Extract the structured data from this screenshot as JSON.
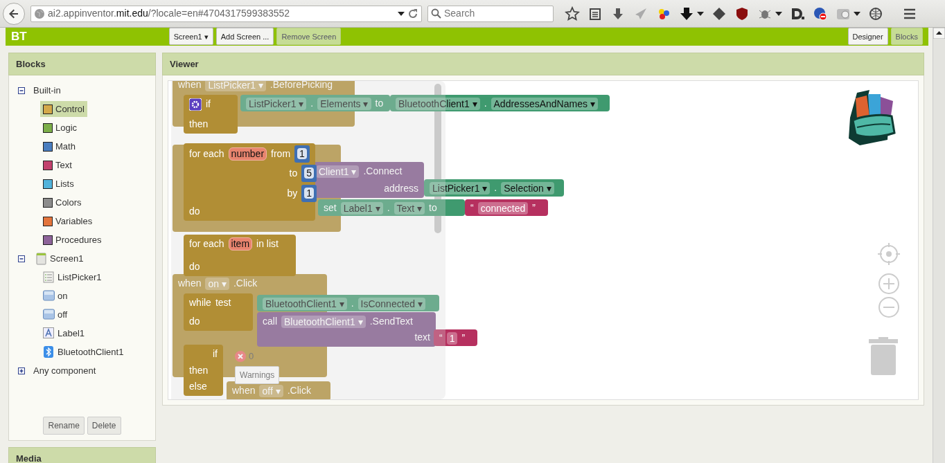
{
  "browser": {
    "url": "ai2.appinventor.**mit.edu**/?locale=en#4704317599383552",
    "search": {
      "placeholder": "Search"
    }
  },
  "app": {
    "project": "BT",
    "screen_button": "Screen1 ▾",
    "buttons": [
      {
        "label": "Add Screen ...",
        "disabled": false
      },
      {
        "label": "Remove Screen",
        "disabled": true
      }
    ],
    "views": [
      {
        "label": "Designer",
        "selected": false
      },
      {
        "label": "Blocks",
        "selected": true
      }
    ]
  },
  "blocks_panel": {
    "title": "Blocks",
    "tree": [
      {
        "label": "Built-in",
        "kind": "group",
        "expanded": true,
        "children": [
          {
            "label": "Control",
            "kind": "category",
            "color": "#d4a94a",
            "selected": true
          },
          {
            "label": "Logic",
            "kind": "category",
            "color": "#7cae4a",
            "selected": false
          },
          {
            "label": "Math",
            "kind": "category",
            "color": "#4a7dbf",
            "selected": false
          },
          {
            "label": "Text",
            "kind": "category",
            "color": "#c2416d",
            "selected": false
          },
          {
            "label": "Lists",
            "kind": "category",
            "color": "#52b3db",
            "selected": false
          },
          {
            "label": "Colors",
            "kind": "category",
            "color": "#8c8c8c",
            "selected": false
          },
          {
            "label": "Variables",
            "kind": "category",
            "color": "#e3743c",
            "selected": false
          },
          {
            "label": "Procedures",
            "kind": "category",
            "color": "#8d6399",
            "selected": false
          }
        ]
      },
      {
        "label": "Screen1",
        "kind": "screen",
        "expanded": true,
        "children": [
          {
            "label": "ListPicker1",
            "kind": "listpicker",
            "selected": false
          },
          {
            "label": "on",
            "kind": "button",
            "selected": false
          },
          {
            "label": "off",
            "kind": "button",
            "selected": false
          },
          {
            "label": "Label1",
            "kind": "label",
            "selected": false
          },
          {
            "label": "BluetoothClient1",
            "kind": "bluetooth",
            "selected": false
          }
        ]
      },
      {
        "label": "Any component",
        "kind": "group",
        "expanded": false
      }
    ],
    "buttons": [
      "Rename",
      "Delete"
    ]
  },
  "media_panel": {
    "title": "Media"
  },
  "viewer": {
    "title": "Viewer",
    "workspace_blocks": [
      {
        "kind": "event",
        "rows": [
          [
            {
              "kind": "label",
              "text": "when"
            },
            {
              "kind": "dd",
              "text": "ListPicker1 ▾"
            },
            {
              "kind": "label",
              "text": ".BeforePicking"
            }
          ]
        ]
      },
      {
        "kind": "setter",
        "rows": [
          [
            {
              "kind": "dd",
              "text": "ListPicker1 ▾"
            },
            {
              "kind": "label",
              "text": "."
            },
            {
              "kind": "dd",
              "text": "Elements ▾"
            },
            {
              "kind": "label",
              "text": "to"
            }
          ]
        ]
      },
      {
        "kind": "getter",
        "rows": [
          [
            {
              "kind": "dd",
              "text": "BluetoothClient1 ▾"
            },
            {
              "kind": "label",
              "text": "."
            },
            {
              "kind": "dd",
              "text": "AddressesAndNames ▾"
            }
          ]
        ]
      },
      {
        "kind": "event"
      },
      {
        "kind": "call",
        "rows": [
          [
            {
              "kind": "dd",
              "text": "Client1 ▾"
            },
            {
              "kind": "label",
              "text": ".Connect"
            }
          ],
          [
            {
              "kind": "label",
              "text": "address"
            }
          ]
        ]
      },
      {
        "kind": "getter",
        "rows": [
          [
            {
              "kind": "dd",
              "text": "ListPicker1 ▾"
            },
            {
              "kind": "label",
              "text": "."
            },
            {
              "kind": "dd",
              "text": "Selection ▾"
            }
          ]
        ]
      },
      {
        "kind": "setter",
        "rows": [
          [
            {
              "kind": "label",
              "text": "set"
            },
            {
              "kind": "dd",
              "text": "Label1 ▾"
            },
            {
              "kind": "label",
              "text": "."
            },
            {
              "kind": "dd",
              "text": "Text ▾"
            },
            {
              "kind": "label",
              "text": "to"
            }
          ]
        ]
      },
      {
        "kind": "text",
        "rows": [
          [
            {
              "kind": "label",
              "text": "“"
            },
            {
              "kind": "str",
              "text": "connected"
            },
            {
              "kind": "label",
              "text": "”"
            }
          ]
        ]
      },
      {
        "kind": "event",
        "rows": [
          [
            {
              "kind": "label",
              "text": "when"
            },
            {
              "kind": "dd",
              "text": "on ▾"
            },
            {
              "kind": "label",
              "text": ".Click"
            }
          ]
        ]
      },
      {
        "kind": "getter",
        "rows": [
          [
            {
              "kind": "dd",
              "text": "BluetoothClient1 ▾"
            },
            {
              "kind": "label",
              "text": "."
            },
            {
              "kind": "dd",
              "text": "IsConnected ▾"
            }
          ]
        ]
      },
      {
        "kind": "call",
        "rows": [
          [
            {
              "kind": "label",
              "text": "call"
            },
            {
              "kind": "dd",
              "text": "BluetoothClient1 ▾"
            },
            {
              "kind": "label",
              "text": ".SendText"
            }
          ],
          [
            {
              "kind": "label",
              "text": "text"
            }
          ]
        ]
      },
      {
        "kind": "text",
        "rows": [
          [
            {
              "kind": "label",
              "text": "“"
            },
            {
              "kind": "str",
              "text": "1"
            },
            {
              "kind": "label",
              "text": "”"
            }
          ]
        ]
      },
      {
        "kind": "event",
        "rows": [
          [
            {
              "kind": "label",
              "text": "when"
            },
            {
              "kind": "dd",
              "text": "off ▾"
            },
            {
              "kind": "label",
              "text": ".Click"
            }
          ]
        ]
      }
    ],
    "warnings": {
      "count": "0",
      "button": "Warnings"
    },
    "flyout_blocks": [
      {
        "kind": "control",
        "mutator": true,
        "rows": [
          [
            {
              "kind": "label",
              "text": "if"
            }
          ],
          [
            {
              "kind": "label",
              "text": "then"
            }
          ]
        ]
      },
      {
        "kind": "control",
        "rows": [
          [
            {
              "kind": "label",
              "text": "for each"
            },
            {
              "kind": "var",
              "text": "number"
            },
            {
              "kind": "label",
              "text": "from"
            },
            {
              "kind": "num",
              "text": "1"
            }
          ],
          [
            {
              "kind": "label",
              "text": "to"
            },
            {
              "kind": "num",
              "text": "5"
            }
          ],
          [
            {
              "kind": "label",
              "text": "by"
            },
            {
              "kind": "num",
              "text": "1"
            }
          ],
          [
            {
              "kind": "label",
              "text": "do"
            }
          ]
        ]
      },
      {
        "kind": "control",
        "rows": [
          [
            {
              "kind": "label",
              "text": "for each"
            },
            {
              "kind": "var",
              "text": "item"
            },
            {
              "kind": "label",
              "text": "in list"
            }
          ],
          [
            {
              "kind": "label",
              "text": "do"
            }
          ]
        ]
      },
      {
        "kind": "control",
        "rows": [
          [
            {
              "kind": "label",
              "text": "while"
            },
            {
              "kind": "label",
              "text": "test"
            }
          ],
          [
            {
              "kind": "label",
              "text": "do"
            }
          ]
        ]
      },
      {
        "kind": "control",
        "rows": [
          [
            {
              "kind": "label",
              "text": "if"
            }
          ],
          [
            {
              "kind": "label",
              "text": "then"
            }
          ],
          [
            {
              "kind": "label",
              "text": "else"
            }
          ]
        ]
      }
    ]
  }
}
